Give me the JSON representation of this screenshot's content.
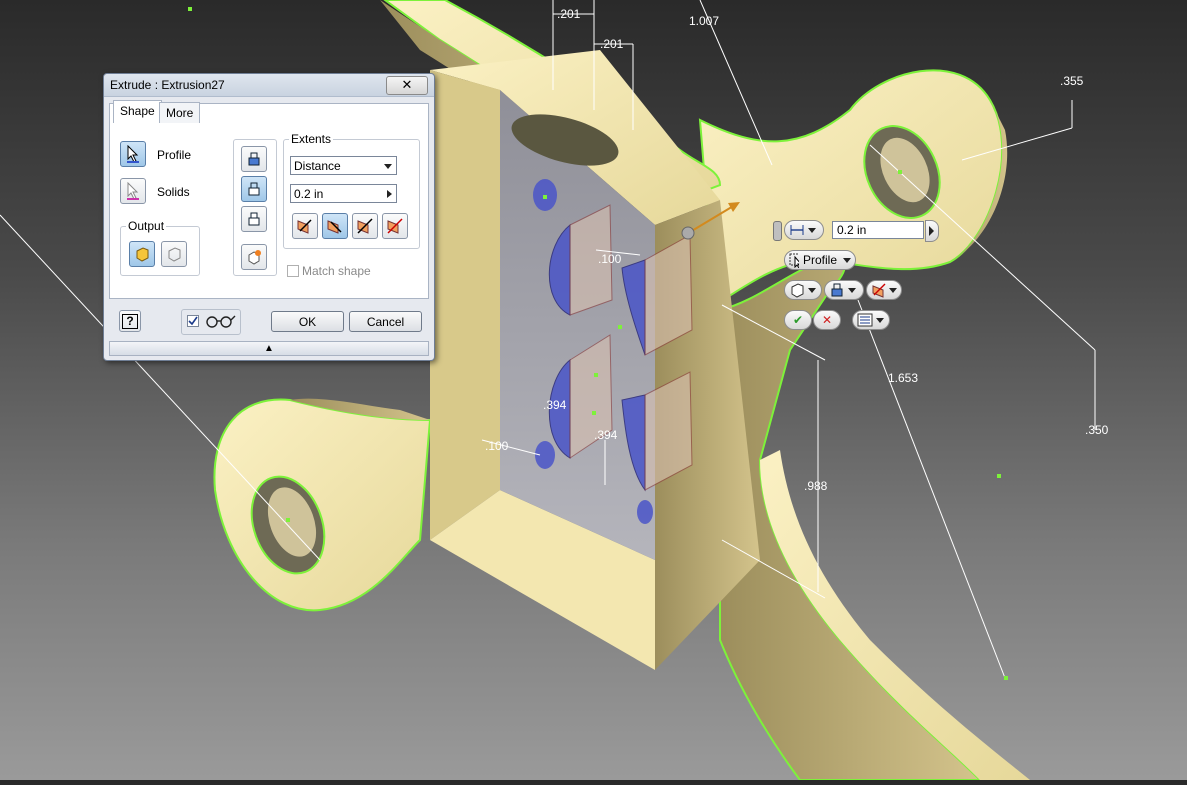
{
  "dialog": {
    "title": "Extrude : Extrusion27",
    "close_label": "✕",
    "tabs": [
      {
        "label": "Shape"
      },
      {
        "label": "More"
      }
    ],
    "profile_label": "Profile",
    "solids_label": "Solids",
    "output_label": "Output",
    "extents_label": "Extents",
    "extents_type": "Distance",
    "distance_value": "0.2 in",
    "match_shape_label": "Match shape",
    "preview_checked": true,
    "ok_label": "OK",
    "cancel_label": "Cancel",
    "help_label": "?",
    "expand_label": "▲"
  },
  "mini_toolbar": {
    "distance_value": "0.2 in",
    "profile_label": "Profile",
    "ok_symbol": "✔",
    "cancel_symbol": "✕"
  },
  "dimensions": [
    {
      "label": ".201"
    },
    {
      "label": ".201"
    },
    {
      "label": "1.007"
    },
    {
      "label": ".355"
    },
    {
      "label": ".100"
    },
    {
      "label": ".394"
    },
    {
      "label": ".394"
    },
    {
      "label": ".100"
    },
    {
      "label": "1.653"
    },
    {
      "label": ".350"
    },
    {
      "label": ".988"
    }
  ],
  "colors": {
    "part_face": "#f3e7b0",
    "part_side": "#b8a872",
    "edge_highlight": "#7df23a",
    "preview_profile": "#4a55c8",
    "accent": "#4a90d9"
  }
}
